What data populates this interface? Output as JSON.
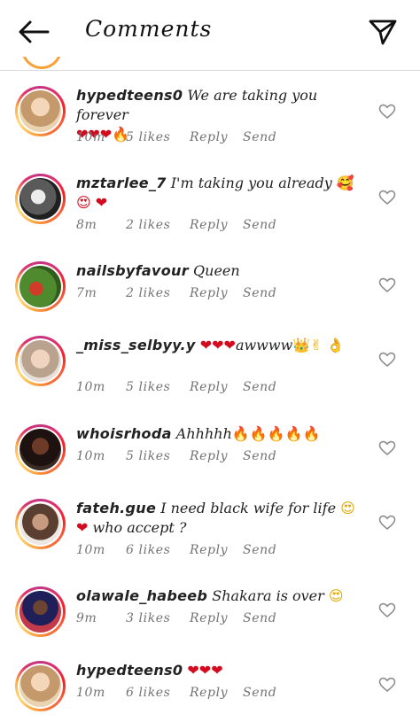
{
  "header": {
    "title": "Comments",
    "back_icon": "back-arrow-icon",
    "send_icon": "paper-plane-icon"
  },
  "comments": [
    {
      "username": "hypedteens0",
      "text": "We are taking you forever",
      "emoji": "❤❤❤🔥",
      "time": "10m",
      "likes": "5 likes",
      "reply": "Reply",
      "send": "Send",
      "avatar_color": "#d8b48a"
    },
    {
      "username": "mztarlee_7",
      "text": "I'm taking you already",
      "emoji": "🥰😍 ❤",
      "time": "8m",
      "likes": "2 likes",
      "reply": "Reply",
      "send": "Send",
      "avatar_color": "#6b6b6b"
    },
    {
      "username": "nailsbyfavour",
      "text": "Queen",
      "emoji": "",
      "time": "7m",
      "likes": "2 likes",
      "reply": "Reply",
      "send": "Send",
      "avatar_color": "#5b8f3a"
    },
    {
      "username": "_miss_selbyy.y",
      "text": "awwww",
      "emoji_before": "❤❤❤",
      "emoji": "👑✌ 👌",
      "time": "10m",
      "likes": "5 likes",
      "reply": "Reply",
      "send": "Send",
      "avatar_color": "#c9b7a6"
    },
    {
      "username": "whoisrhoda",
      "text": "Ahhhhh",
      "emoji": "🔥🔥🔥🔥🔥",
      "time": "10m",
      "likes": "5 likes",
      "reply": "Reply",
      "send": "Send",
      "avatar_color": "#2b1a16"
    },
    {
      "username": "fateh.gue",
      "text": "I need black wife for life",
      "emoji": "😍",
      "emoji2": "❤",
      "text2": "who accept ?",
      "time": "10m",
      "likes": "6 likes",
      "reply": "Reply",
      "send": "Send",
      "avatar_color": "#8a6a55"
    },
    {
      "username": "olawale_habeeb",
      "text": "Shakara is over",
      "emoji": "😍",
      "time": "9m",
      "likes": "3 likes",
      "reply": "Reply",
      "send": "Send",
      "avatar_color": "#c33a4a"
    },
    {
      "username": "hypedteens0",
      "text": "",
      "emoji": "❤❤❤",
      "time": "10m",
      "likes": "6 likes",
      "reply": "Reply",
      "send": "Send",
      "avatar_color": "#d8b48a"
    }
  ]
}
